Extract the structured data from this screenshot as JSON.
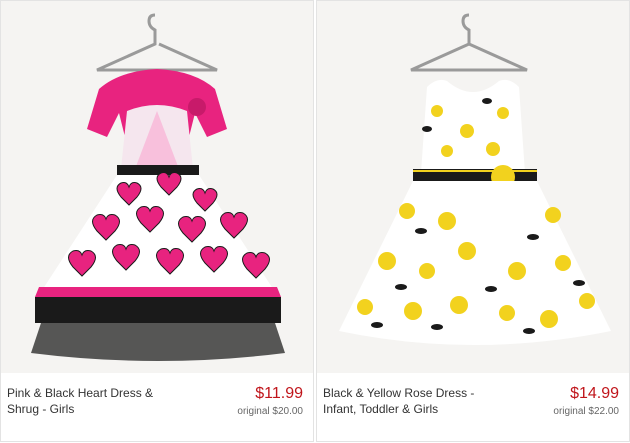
{
  "products": [
    {
      "title": "Pink & Black Heart Dress & Shrug - Girls",
      "price": "$11.99",
      "original_price": "original $20.00",
      "colors": {
        "primary": "#e8237f",
        "secondary": "#1a1a1a",
        "background": "#f5f4f2"
      }
    },
    {
      "title": "Black & Yellow Rose Dress - Infant, Toddler & Girls",
      "price": "$14.99",
      "original_price": "original $22.00",
      "colors": {
        "primary": "#f2d21e",
        "secondary": "#1a1a1a",
        "background": "#f5f4f2"
      }
    }
  ]
}
